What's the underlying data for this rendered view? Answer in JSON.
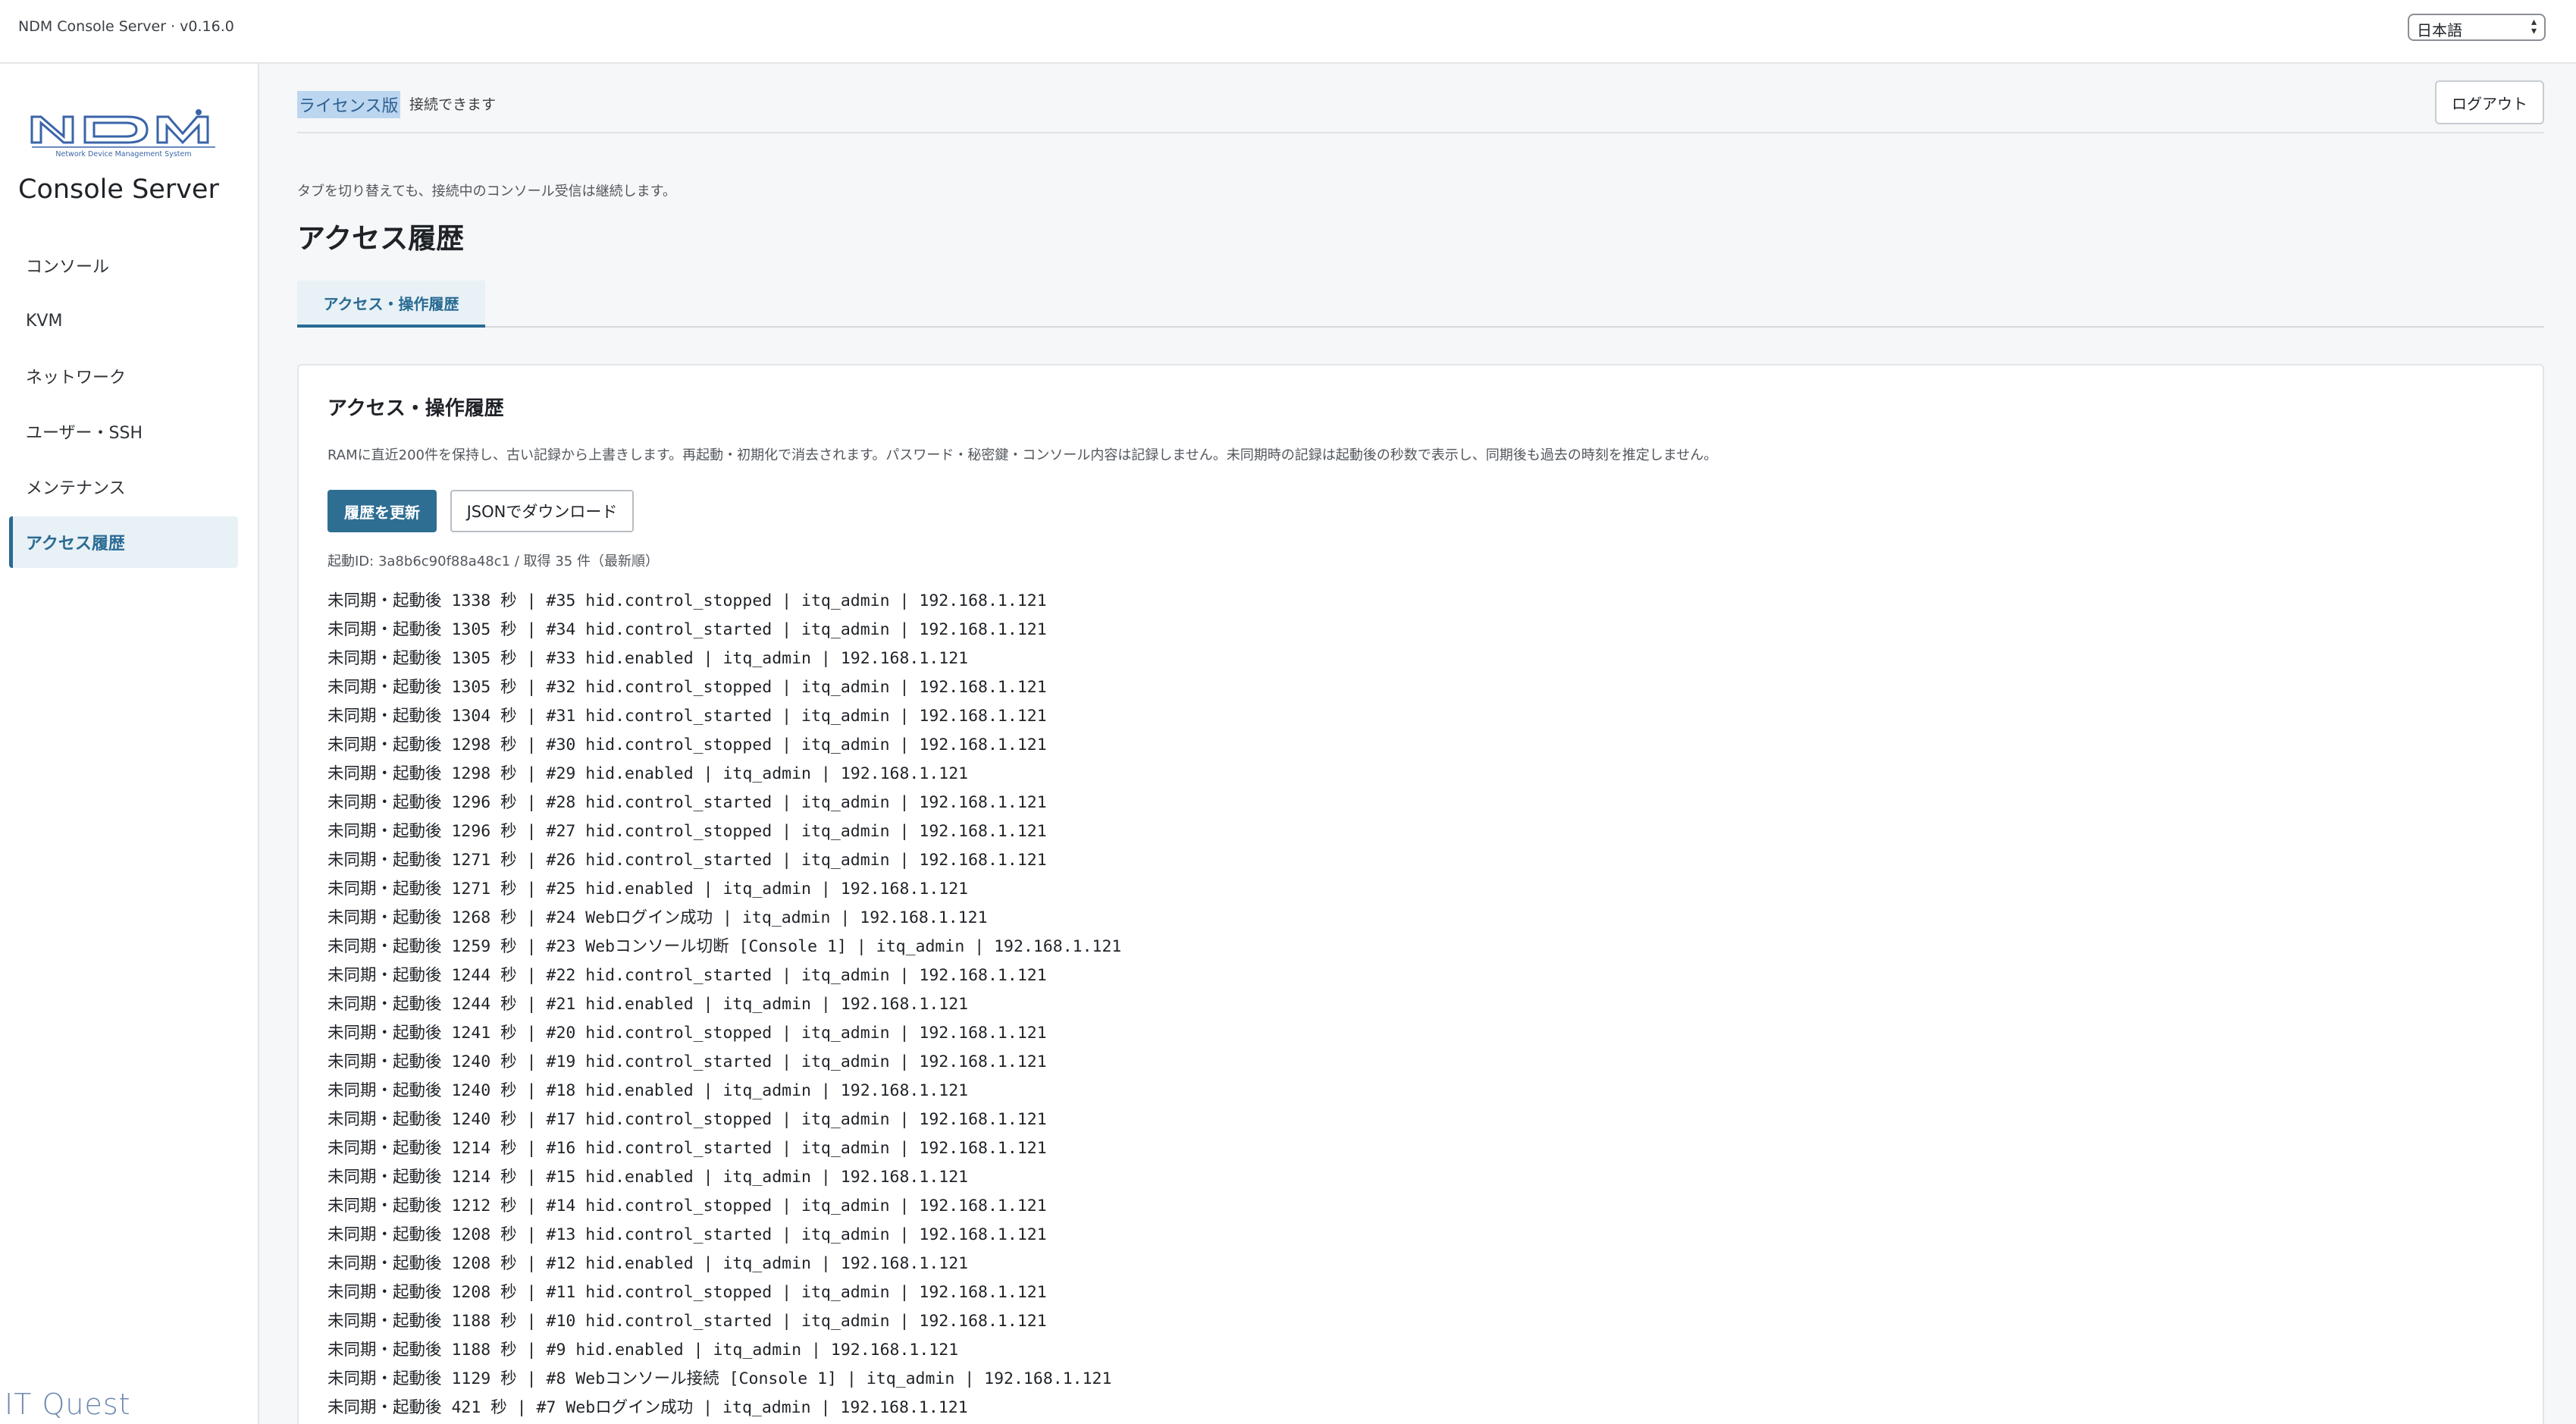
{
  "topbar": {
    "app_version": "NDM Console Server · v0.16.0",
    "language": "日本語"
  },
  "sidebar": {
    "logo_text": "NDM",
    "logo_subtitle": "Network Device Management System",
    "brand": "Console Server",
    "items": [
      {
        "label": "コンソール"
      },
      {
        "label": "KVM"
      },
      {
        "label": "ネットワーク"
      },
      {
        "label": "ユーザー・SSH"
      },
      {
        "label": "メンテナンス"
      },
      {
        "label": "アクセス履歴"
      }
    ],
    "footer_logo": "IT Quest"
  },
  "header": {
    "license_badge": "ライセンス版",
    "license_status": "接続できます",
    "logout_label": "ログアウト"
  },
  "main": {
    "notice": "タブを切り替えても、接続中のコンソール受信は継続します。",
    "page_title": "アクセス履歴",
    "tabs": [
      {
        "label": "アクセス・操作履歴"
      }
    ],
    "card": {
      "title": "アクセス・操作履歴",
      "description": "RAMに直近200件を保持し、古い記録から上書きします。再起動・初期化で消去されます。パスワード・秘密鍵・コンソール内容は記録しません。未同期時の記録は起動後の秒数で表示し、同期後も過去の時刻を推定しません。",
      "refresh_label": "履歴を更新",
      "download_label": "JSONでダウンロード",
      "meta": "起動ID: 3a8b6c90f88a48c1 / 取得 35 件（最新順）",
      "log_lines": [
        "未同期・起動後 1338 秒 | #35 hid.control_stopped | itq_admin | 192.168.1.121",
        "未同期・起動後 1305 秒 | #34 hid.control_started | itq_admin | 192.168.1.121",
        "未同期・起動後 1305 秒 | #33 hid.enabled | itq_admin | 192.168.1.121",
        "未同期・起動後 1305 秒 | #32 hid.control_stopped | itq_admin | 192.168.1.121",
        "未同期・起動後 1304 秒 | #31 hid.control_started | itq_admin | 192.168.1.121",
        "未同期・起動後 1298 秒 | #30 hid.control_stopped | itq_admin | 192.168.1.121",
        "未同期・起動後 1298 秒 | #29 hid.enabled | itq_admin | 192.168.1.121",
        "未同期・起動後 1296 秒 | #28 hid.control_started | itq_admin | 192.168.1.121",
        "未同期・起動後 1296 秒 | #27 hid.control_stopped | itq_admin | 192.168.1.121",
        "未同期・起動後 1271 秒 | #26 hid.control_started | itq_admin | 192.168.1.121",
        "未同期・起動後 1271 秒 | #25 hid.enabled | itq_admin | 192.168.1.121",
        "未同期・起動後 1268 秒 | #24 Webログイン成功 | itq_admin | 192.168.1.121",
        "未同期・起動後 1259 秒 | #23 Webコンソール切断 [Console 1] | itq_admin | 192.168.1.121",
        "未同期・起動後 1244 秒 | #22 hid.control_started | itq_admin | 192.168.1.121",
        "未同期・起動後 1244 秒 | #21 hid.enabled | itq_admin | 192.168.1.121",
        "未同期・起動後 1241 秒 | #20 hid.control_stopped | itq_admin | 192.168.1.121",
        "未同期・起動後 1240 秒 | #19 hid.control_started | itq_admin | 192.168.1.121",
        "未同期・起動後 1240 秒 | #18 hid.enabled | itq_admin | 192.168.1.121",
        "未同期・起動後 1240 秒 | #17 hid.control_stopped | itq_admin | 192.168.1.121",
        "未同期・起動後 1214 秒 | #16 hid.control_started | itq_admin | 192.168.1.121",
        "未同期・起動後 1214 秒 | #15 hid.enabled | itq_admin | 192.168.1.121",
        "未同期・起動後 1212 秒 | #14 hid.control_stopped | itq_admin | 192.168.1.121",
        "未同期・起動後 1208 秒 | #13 hid.control_started | itq_admin | 192.168.1.121",
        "未同期・起動後 1208 秒 | #12 hid.enabled | itq_admin | 192.168.1.121",
        "未同期・起動後 1208 秒 | #11 hid.control_stopped | itq_admin | 192.168.1.121",
        "未同期・起動後 1188 秒 | #10 hid.control_started | itq_admin | 192.168.1.121",
        "未同期・起動後 1188 秒 | #9 hid.enabled | itq_admin | 192.168.1.121",
        "未同期・起動後 1129 秒 | #8 Webコンソール接続 [Console 1] | itq_admin | 192.168.1.121",
        "未同期・起動後 421 秒 | #7 Webログイン成功 | itq_admin | 192.168.1.121"
      ]
    }
  },
  "colors": {
    "accent": "#2a6b93",
    "button_primary": "#2e6e93",
    "badge_bg": "#bcd6f0"
  }
}
